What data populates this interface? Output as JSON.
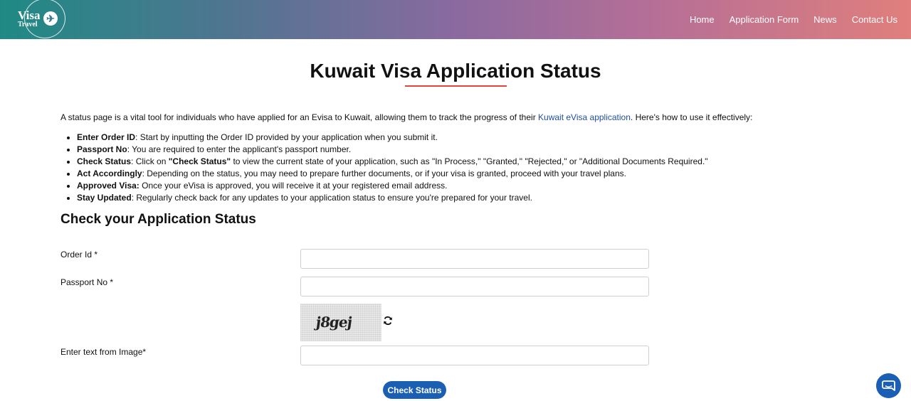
{
  "header": {
    "logo_visa": "Visa",
    "logo_travel": "Travel",
    "nav": [
      {
        "label": "Home"
      },
      {
        "label": "Application Form"
      },
      {
        "label": "News"
      },
      {
        "label": "Contact Us"
      }
    ]
  },
  "page": {
    "title": "Kuwait Visa Application Status",
    "intro_before": "A status page is a vital tool for individuals who have applied for an Evisa to Kuwait, allowing them to track the progress of their ",
    "intro_link": "Kuwait eVisa application",
    "intro_after": ". Here's how to use it effectively:",
    "bullets": [
      {
        "term": "Enter Order ID",
        "text": ": Start by inputting the Order ID provided by your application when you submit it."
      },
      {
        "term": "Passport No",
        "text": ": You are required to enter the applicant's passport number."
      },
      {
        "term": "Check Status",
        "text_pre": ": Click on ",
        "bold_mid": "\"Check Status\"",
        "text": " to view the current state of your application, such as \"In Process,\" \"Granted,\" \"Rejected,\" or \"Additional Documents Required.\""
      },
      {
        "term": "Act Accordingly",
        "text": ": Depending on the status, you may need to prepare further documents, or if your visa is granted, proceed with your travel plans."
      },
      {
        "term": "Approved Visa:",
        "text": " Once your eVisa is approved, you will receive it at your registered email address."
      },
      {
        "term": "Stay Updated",
        "text": ": Regularly check back for any updates to your application status to ensure you're prepared for your travel."
      }
    ]
  },
  "form": {
    "section_title": "Check your Application Status",
    "order_id_label": "Order Id *",
    "order_id_value": "",
    "passport_label": "Passport No *",
    "passport_value": "",
    "captcha_text": "j8gej",
    "captcha_label": "Enter text from Image*",
    "captcha_value": "",
    "submit_label": "Check Status"
  },
  "icons": {
    "logo": "plane-icon",
    "refresh": "refresh-icon",
    "chat": "chat-icon"
  },
  "colors": {
    "accent": "#1a5fb4",
    "title_underline": "#e5443b",
    "link": "#1f4fa0"
  }
}
